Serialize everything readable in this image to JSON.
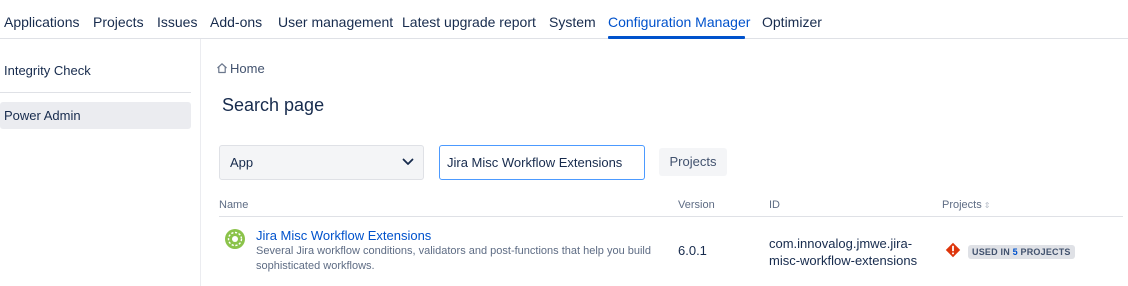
{
  "nav": {
    "tabs": [
      {
        "label": "Applications"
      },
      {
        "label": "Projects"
      },
      {
        "label": "Issues"
      },
      {
        "label": "Add-ons"
      },
      {
        "label": "User management"
      },
      {
        "label": "Latest upgrade report"
      },
      {
        "label": "System"
      },
      {
        "label": "Configuration Manager",
        "active": true
      },
      {
        "label": "Optimizer"
      }
    ]
  },
  "sidebar": {
    "items": [
      {
        "label": "Integrity Check"
      },
      {
        "label": "Power Admin",
        "selected": true
      }
    ]
  },
  "breadcrumb": {
    "home_label": "Home",
    "icon": "home-icon"
  },
  "page": {
    "title": "Search page"
  },
  "filters": {
    "type_select": {
      "value": "App",
      "icon": "chevron-down-icon"
    },
    "search": {
      "value": "Jira Misc Workflow Extensions"
    },
    "projects_button": "Projects"
  },
  "table": {
    "columns": {
      "name": "Name",
      "version": "Version",
      "id": "ID",
      "projects": "Projects"
    },
    "rows": [
      {
        "name": "Jira Misc Workflow Extensions",
        "description": "Several Jira workflow conditions, validators and post-functions that help you build sophisticated workflows.",
        "version": "6.0.1",
        "id": "com.innovalog.jmwe.jira-misc-workflow-extensions",
        "projects_badge": {
          "prefix": "USED IN ",
          "count": "5",
          "suffix": " PROJECTS"
        },
        "icon": "app-logo-icon",
        "warning_icon": "warning-icon"
      }
    ]
  },
  "colors": {
    "accent": "#0052cc",
    "text": "#172b4d",
    "muted": "#5e6c84",
    "warning": "#de350b",
    "app_icon": "#8bc34a"
  }
}
